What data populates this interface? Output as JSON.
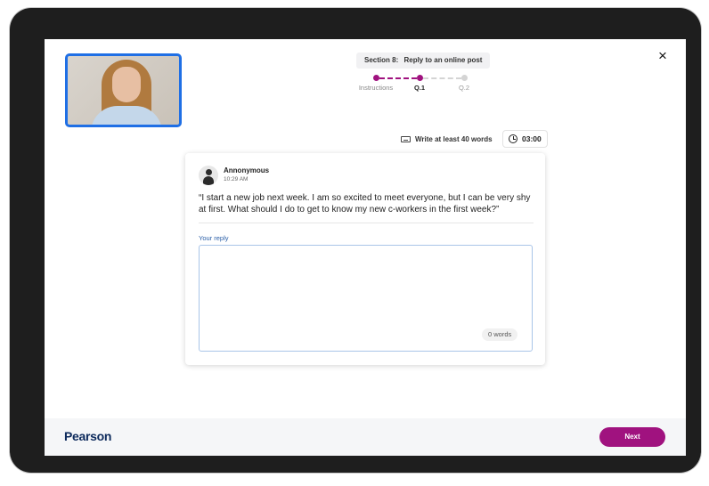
{
  "header": {
    "section_label": "Section 8:",
    "section_name": "Reply to an online post"
  },
  "stepper": {
    "steps": [
      {
        "label": "Instructions",
        "state": "done"
      },
      {
        "label": "Q.1",
        "state": "current"
      },
      {
        "label": "Q.2",
        "state": "upcoming"
      }
    ]
  },
  "task": {
    "hint": "Write at least 40 words",
    "hint_icon": "keyboard-icon",
    "timer": "03:00",
    "timer_icon": "clock-icon"
  },
  "post": {
    "author": "Annonymous",
    "time": "10:29 AM",
    "text": "“I start a new job next week. I am so excited to meet everyone, but I can be very shy at first. What should I do to get to know my new c-workers in the first week?”"
  },
  "reply": {
    "label": "Your reply",
    "value": "",
    "word_count": "0 words"
  },
  "footer": {
    "logo": "Pearson",
    "next_label": "Next"
  },
  "colors": {
    "accent": "#a0127f",
    "video_border": "#1f6fe5",
    "inactive": "#d4d4d4"
  }
}
